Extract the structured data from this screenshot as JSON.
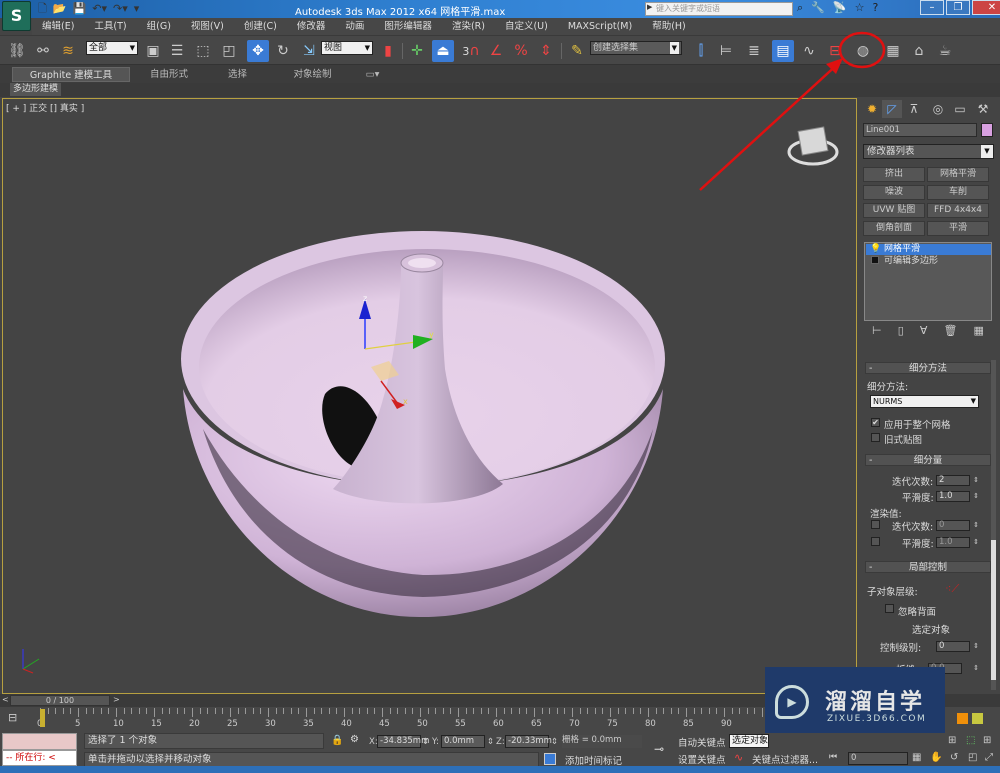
{
  "app": {
    "title": "Autodesk 3ds Max  2012 x64    网格平滑.max",
    "logo": "S",
    "search_placeholder": "键入关键字或短语",
    "title_icons": [
      "binoculars-icon",
      "wrench-icon",
      "satellite-icon",
      "star-icon",
      "help-icon"
    ],
    "window_buttons": [
      "–",
      "❐",
      "✕"
    ]
  },
  "menu": [
    "编辑(E)",
    "工具(T)",
    "组(G)",
    "视图(V)",
    "创建(C)",
    "修改器",
    "动画",
    "图形编辑器",
    "渲染(R)",
    "自定义(U)",
    "MAXScript(M)",
    "帮助(H)"
  ],
  "toolbar": {
    "selection_filter": "全部",
    "ref_coord": "视图",
    "named_selection": "创建选择集",
    "snap_3": "3"
  },
  "ribbon": {
    "tabs": [
      "Graphite 建模工具",
      "自由形式",
      "选择",
      "对象绘制"
    ],
    "active_tab": "Graphite 建模工具",
    "sub_tab": "多边形建模"
  },
  "viewport": {
    "label": "[ + ] 正交 [] 真实 ]",
    "gizmo_axes": {
      "x": "x",
      "y": "y",
      "z": "z"
    },
    "object_color": "#d9bfe0"
  },
  "command_panel": {
    "object_name": "Line001",
    "object_color": "#d8a0e0",
    "modifier_list": "修改器列表",
    "modifier_buttons": [
      "挤出",
      "网格平滑",
      "噪波",
      "车削",
      "UVW 贴图",
      "FFD 4x4x4",
      "倒角剖面",
      "平滑"
    ],
    "stack": [
      {
        "label": "网格平滑",
        "selected": true
      },
      {
        "label": "可编辑多边形",
        "selected": false
      }
    ],
    "rollouts": {
      "subdivision_method": {
        "title": "细分方法",
        "label": "细分方法:",
        "method": "NURMS",
        "apply_whole_mesh": {
          "label": "应用于整个网格",
          "checked": true
        },
        "old_style_mapping": {
          "label": "旧式贴图",
          "checked": false
        }
      },
      "subdivision_amount": {
        "title": "细分量",
        "iterations_label": "迭代次数:",
        "iterations": "2",
        "smoothness_label": "平滑度:",
        "smoothness": "1.0",
        "render_values_label": "渲染值:",
        "render_iterations_label": "迭代次数:",
        "render_iterations": "0",
        "render_smoothness_label": "平滑度:",
        "render_smoothness": "1.0"
      },
      "local_control": {
        "title": "局部控制",
        "sub_object_level_label": "子对象层级:",
        "ignore_backfacing": "忽略背面",
        "selected_object": "选定对象",
        "control_level_label": "控制级别:",
        "control_level": "0",
        "crease_label": "折缝:",
        "crease": "0.0"
      }
    }
  },
  "timeline": {
    "frame_display": "0 / 100",
    "prev": "<",
    "next": ">",
    "ticks": [
      "0",
      "5",
      "10",
      "15",
      "20",
      "25",
      "30",
      "35",
      "40",
      "45",
      "50",
      "55",
      "60",
      "65",
      "70",
      "75",
      "80",
      "85",
      "90"
    ]
  },
  "status": {
    "listener_label": "所在行:",
    "selection_msg": "选择了 1 个对象",
    "prompt": "单击并拖动以选择并移动对象",
    "x_label": "X:",
    "x": "-34.835mm",
    "y_label": "Y:",
    "y": "0.0mm",
    "z_label": "Z:",
    "z": "-20.33mm",
    "grid": "栅格 = 0.0mm",
    "add_time_tag": "添加时间标记",
    "auto_key": "自动关键点",
    "set_key": "设置关键点",
    "selected_set": "选定对象",
    "key_filters": "关键点过滤器...",
    "current_frame": "0"
  },
  "watermark": {
    "title": "溜溜自学",
    "url": "ZIXUE.3D66.COM"
  },
  "annotation": {
    "color": "#e01010"
  }
}
